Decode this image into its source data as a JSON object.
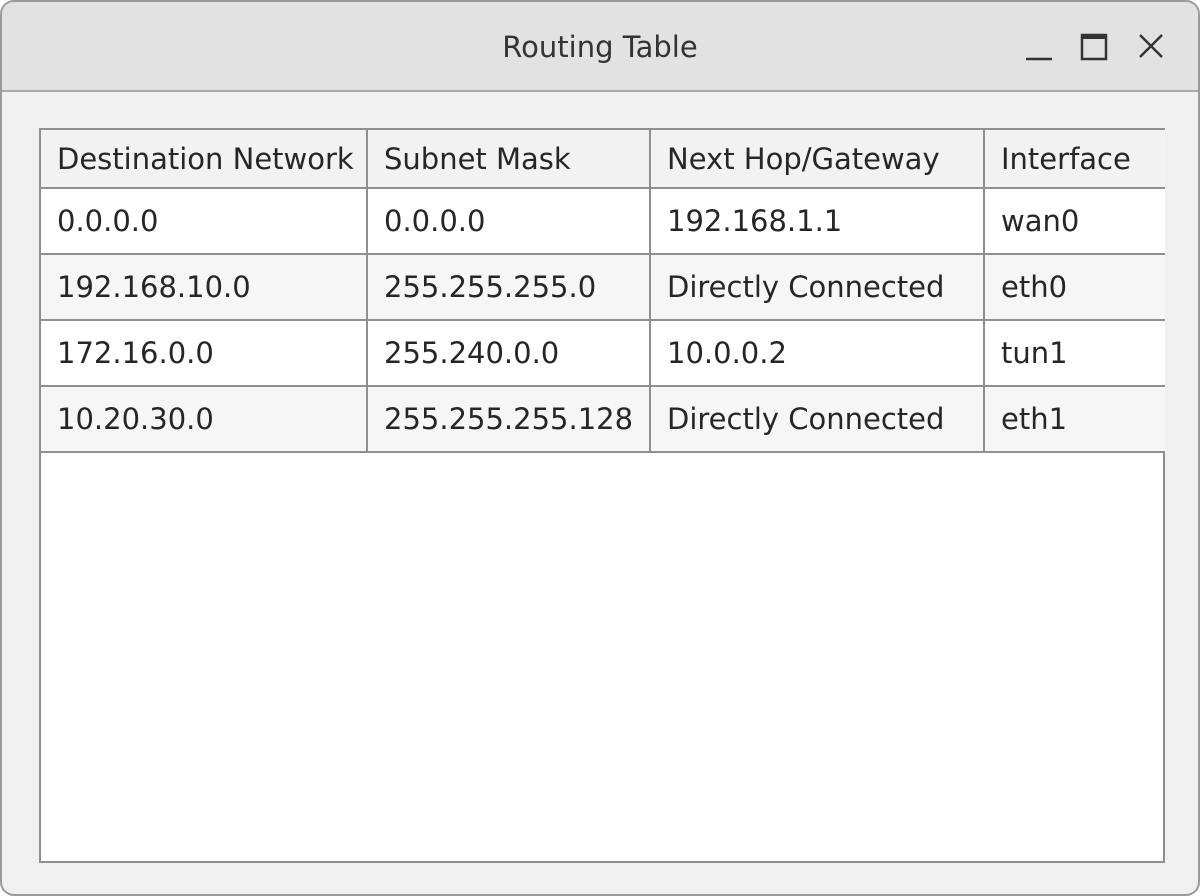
{
  "window": {
    "title": "Routing Table",
    "controls": {
      "minimize_icon": "minimize-icon",
      "maximize_icon": "maximize-icon",
      "close_icon": "close-icon"
    }
  },
  "table": {
    "columns": [
      "Destination Network",
      "Subnet Mask",
      "Next Hop/Gateway",
      "Interface"
    ],
    "rows": [
      [
        "0.0.0.0",
        "0.0.0.0",
        "192.168.1.1",
        "wan0"
      ],
      [
        "192.168.10.0",
        "255.255.255.0",
        "Directly Connected",
        "eth0"
      ],
      [
        "172.16.0.0",
        "255.240.0.0",
        "10.0.0.2",
        "tun1"
      ],
      [
        "10.20.30.0",
        "255.255.255.128",
        "Directly Connected",
        "eth1"
      ]
    ]
  },
  "colors": {
    "titlebar": "#e2e2e2",
    "window_bg": "#f0f0f0",
    "table_border": "#8f8f8f",
    "header_bg": "#f2f2f2"
  }
}
